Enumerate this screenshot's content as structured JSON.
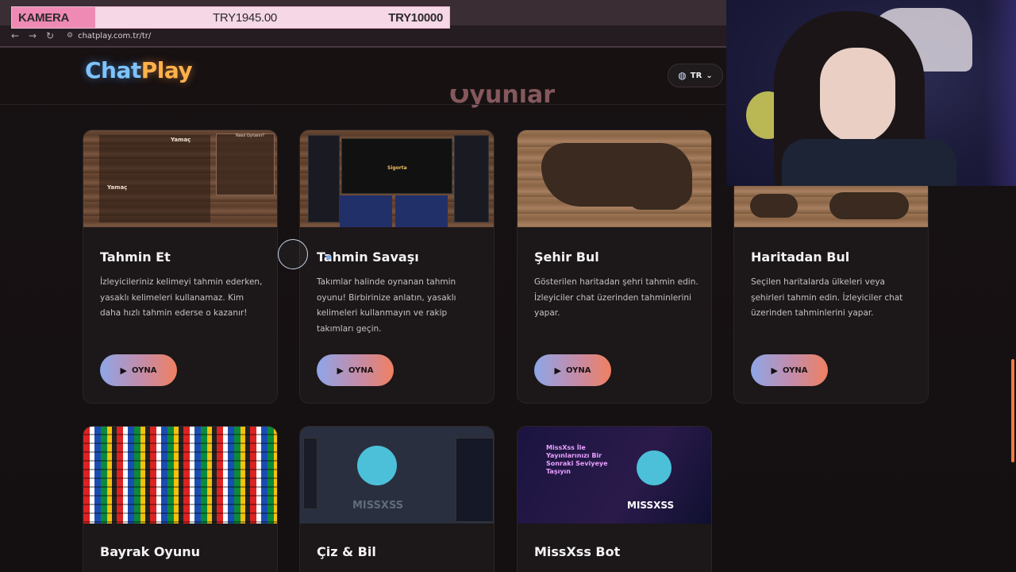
{
  "overlay": {
    "label": "KAMERA",
    "current": "TRY1945.00",
    "target": "TRY10000",
    "fill_fraction": 0.19
  },
  "browser": {
    "url": "chatplay.com.tr/tr/"
  },
  "header": {
    "logo_part1": "Chat",
    "logo_part2": "Play",
    "language": "TR",
    "section_title": "Oyunlar"
  },
  "cards": [
    {
      "title": "Tahmin Et",
      "description": "İzleyicileriniz kelimeyi tahmin ederken, yasaklı kelimeleri kullanamaz. Kim daha hızlı tahmin ederse o kazanır!",
      "button": "OYNA"
    },
    {
      "title": "Tahmin Savaşı",
      "description": "Takımlar halinde oynanan tahmin oyunu! Birbirinize anlatın, yasaklı kelimeleri kullanmayın ve rakip takımları geçin.",
      "button": "OYNA"
    },
    {
      "title": "Şehir Bul",
      "description": "Gösterilen haritadan şehri tahmin edin. İzleyiciler chat üzerinden tahminlerini yapar.",
      "button": "OYNA"
    },
    {
      "title": "Haritadan Bul",
      "description": "Seçilen haritalarda ülkeleri veya şehirleri tahmin edin. İzleyiciler chat üzerinden tahminlerini yapar.",
      "button": "OYNA"
    },
    {
      "title": "Bayrak Oyunu"
    },
    {
      "title": "Çiz & Bil"
    },
    {
      "title": "MissXss Bot"
    }
  ],
  "thumb_text": {
    "yamac1": "Yamaç",
    "yamac2": "Yamaç",
    "nasil": "Nasıl Oynanır?",
    "sigorta": "Sigorta",
    "missxss": "MISSXSS",
    "missxss_heading": "MissXss İle Yayınlarınızı Bir Sonraki Seviyeye Taşıyın"
  },
  "colors": {
    "accent_orange": "#f08060",
    "accent_blue": "#8ea6e8",
    "background": "#15100f"
  }
}
